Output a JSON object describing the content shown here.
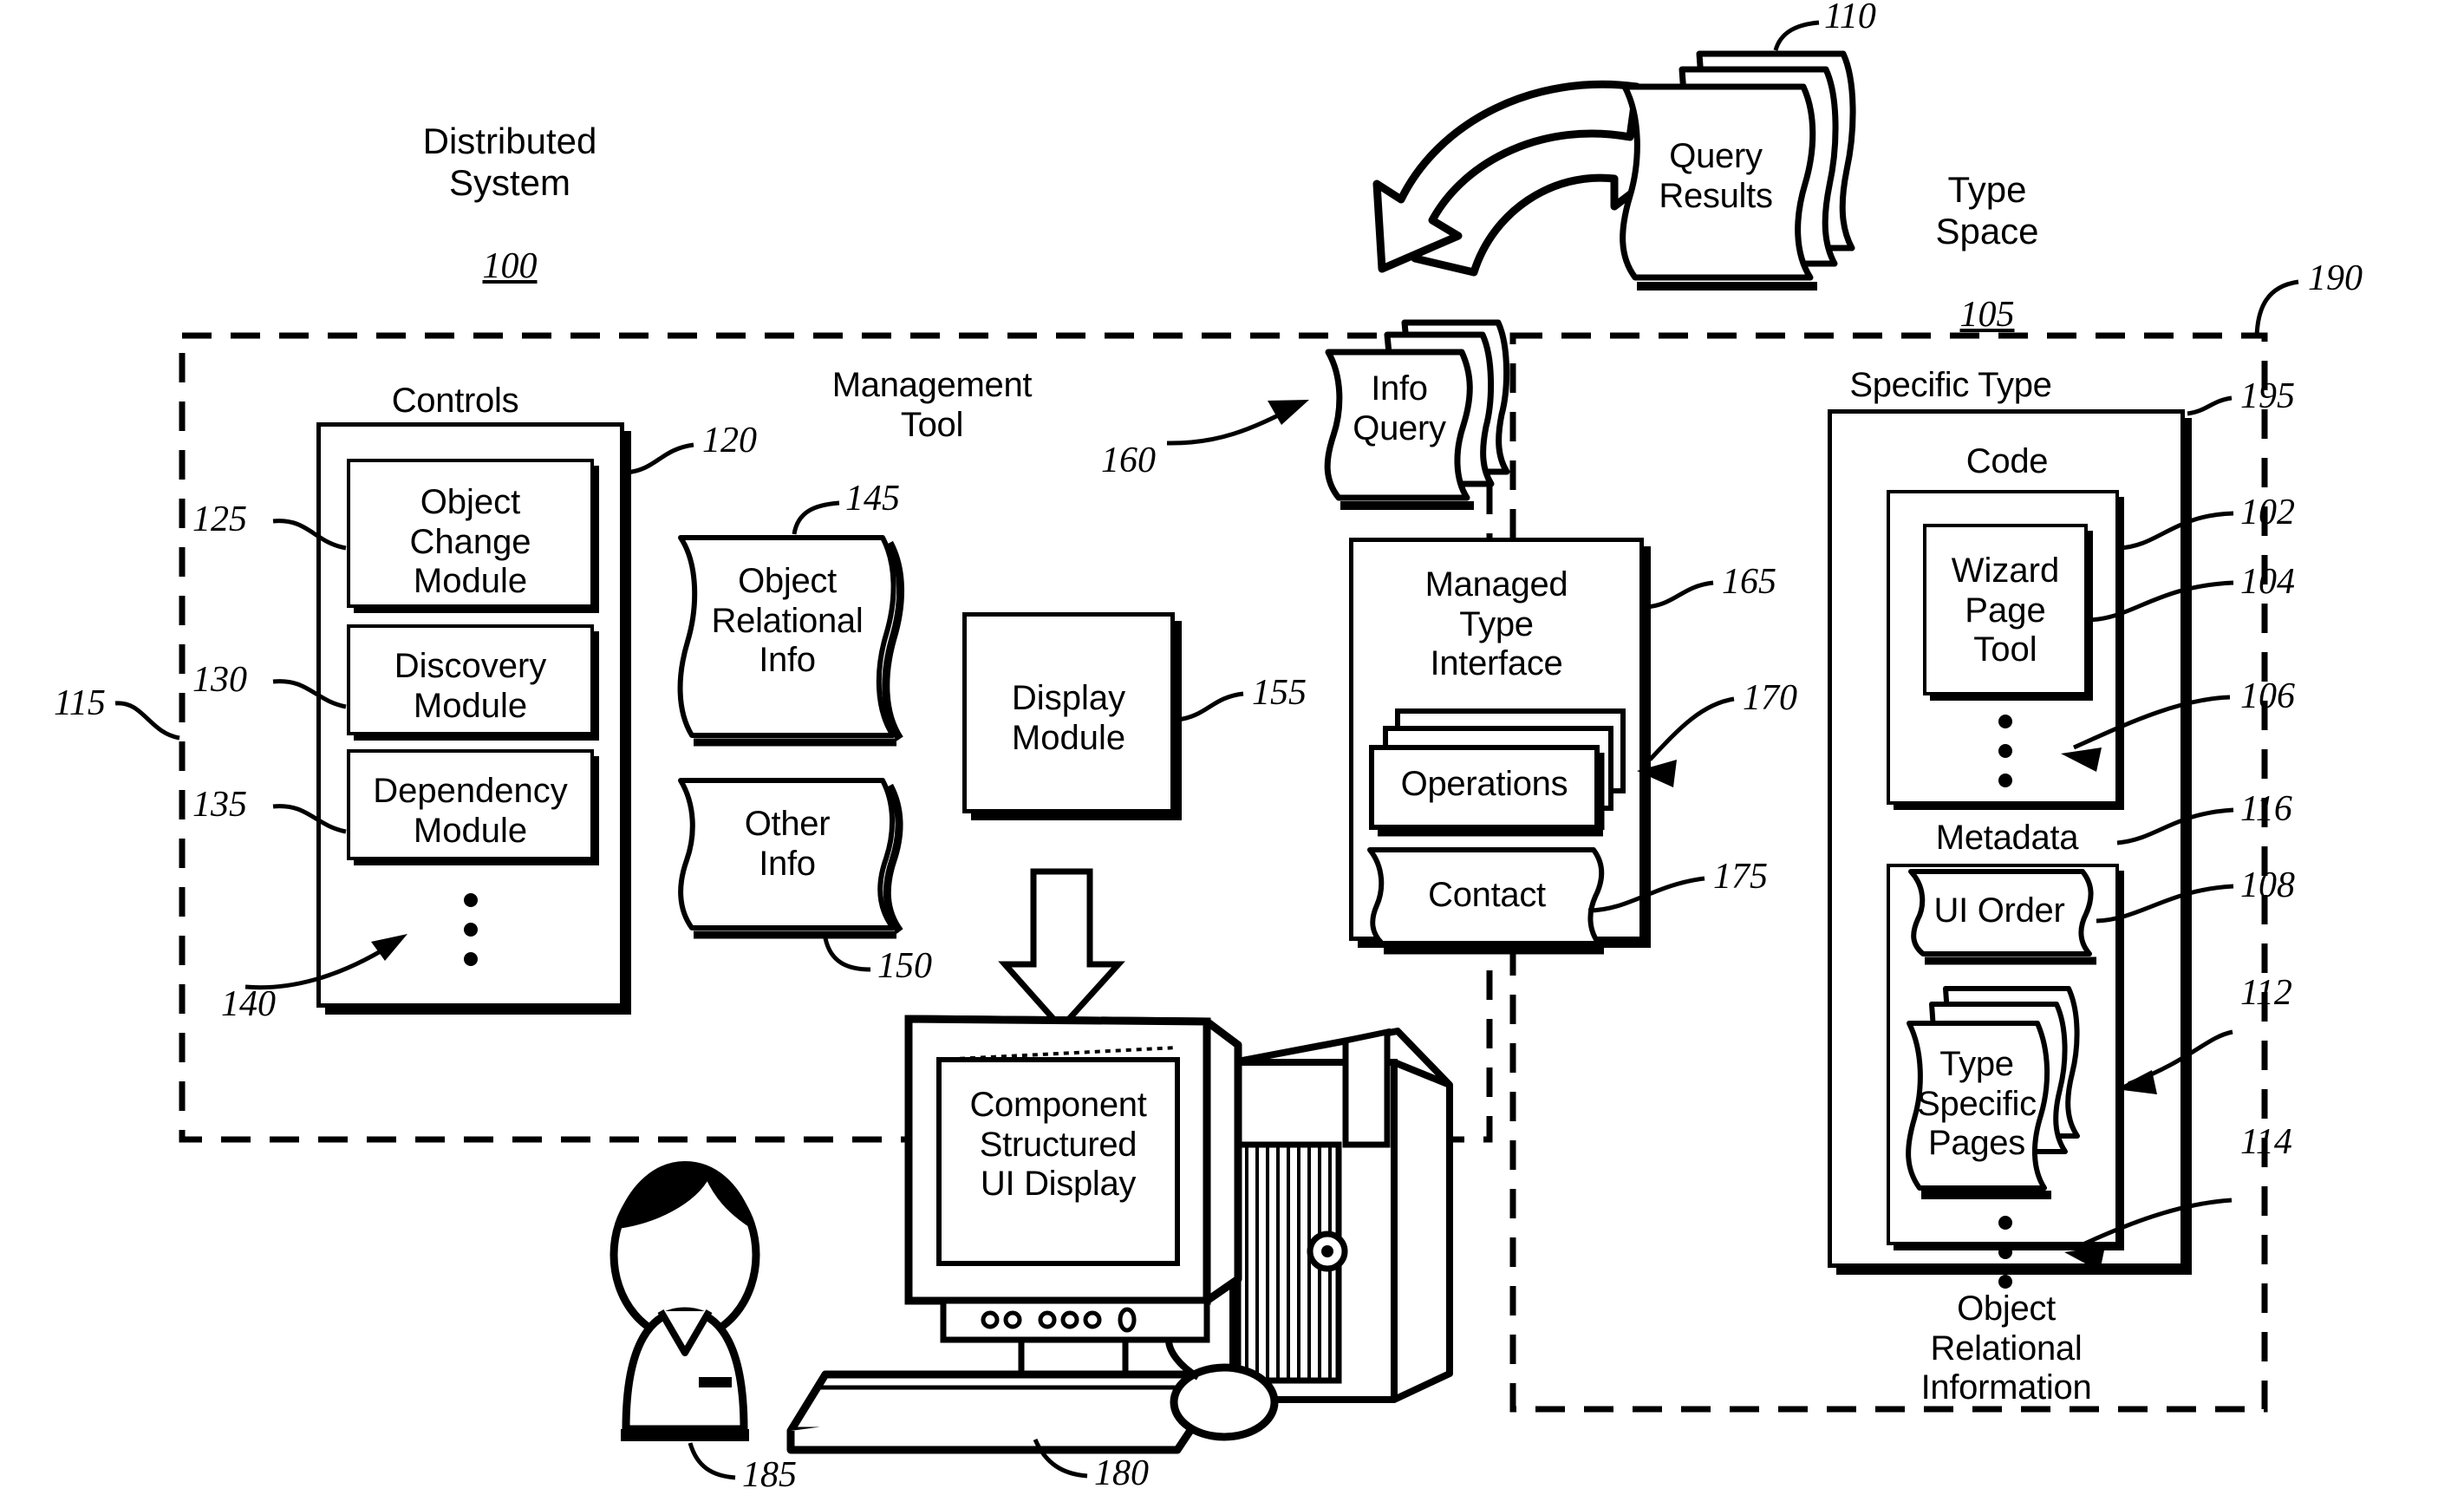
{
  "figure": {
    "kind": "patent-system-diagram"
  },
  "regions": {
    "distributed_system": {
      "title": "Distributed\nSystem",
      "ref": "100"
    },
    "type_space": {
      "title": "Type\nSpace",
      "ref": "105"
    },
    "left_boundary_ref": "115",
    "right_boundary_ref": "190"
  },
  "left_panel": {
    "management_tool_label": "Management\nTool",
    "management_tool_ref": "120",
    "controls_label": "Controls",
    "controls_ref": "120",
    "controls_more_ref": "140",
    "modules": [
      {
        "label": "Object\nChange\nModule",
        "ref": "125"
      },
      {
        "label": "Discovery\nModule",
        "ref": "130"
      },
      {
        "label": "Dependency\nModule",
        "ref": "135"
      }
    ],
    "docs": [
      {
        "label": "Object\nRelational\nInfo",
        "ref": "145"
      },
      {
        "label": "Other\nInfo",
        "ref": "150"
      }
    ],
    "display_module": {
      "label": "Display\nModule",
      "ref": "155"
    }
  },
  "flows": {
    "query_results": {
      "label": "Query\nResults",
      "ref": "110"
    },
    "info_query": {
      "label": "Info\nQuery",
      "ref": "160"
    }
  },
  "managed_type_interface": {
    "label": "Managed\nType\nInterface",
    "ref": "165",
    "operations": {
      "label": "Operations",
      "ref": "170"
    },
    "contact": {
      "label": "Contact",
      "ref": "175"
    }
  },
  "right_panel": {
    "specific_type_label": "Specific Type",
    "specific_type_ref": "195",
    "code_label": "Code",
    "code_ref": "102",
    "wizard_page_tool": {
      "label": "Wizard\nPage\nTool",
      "ref": "104"
    },
    "code_more_ref": "106",
    "metadata_label": "Metadata",
    "metadata_ref": "116",
    "ui_order": {
      "label": "UI Order",
      "ref": "108"
    },
    "type_specific_pages": {
      "label": "Type\nSpecific\nPages",
      "ref": "112"
    },
    "metadata_more_ref": "114",
    "footer_label": "Object\nRelational\nInformation"
  },
  "workstation": {
    "screen_text": "Component\nStructured\nUI Display",
    "computer_ref": "180",
    "user_ref": "185"
  },
  "colors": {
    "ink": "#000000",
    "paper": "#ffffff"
  }
}
